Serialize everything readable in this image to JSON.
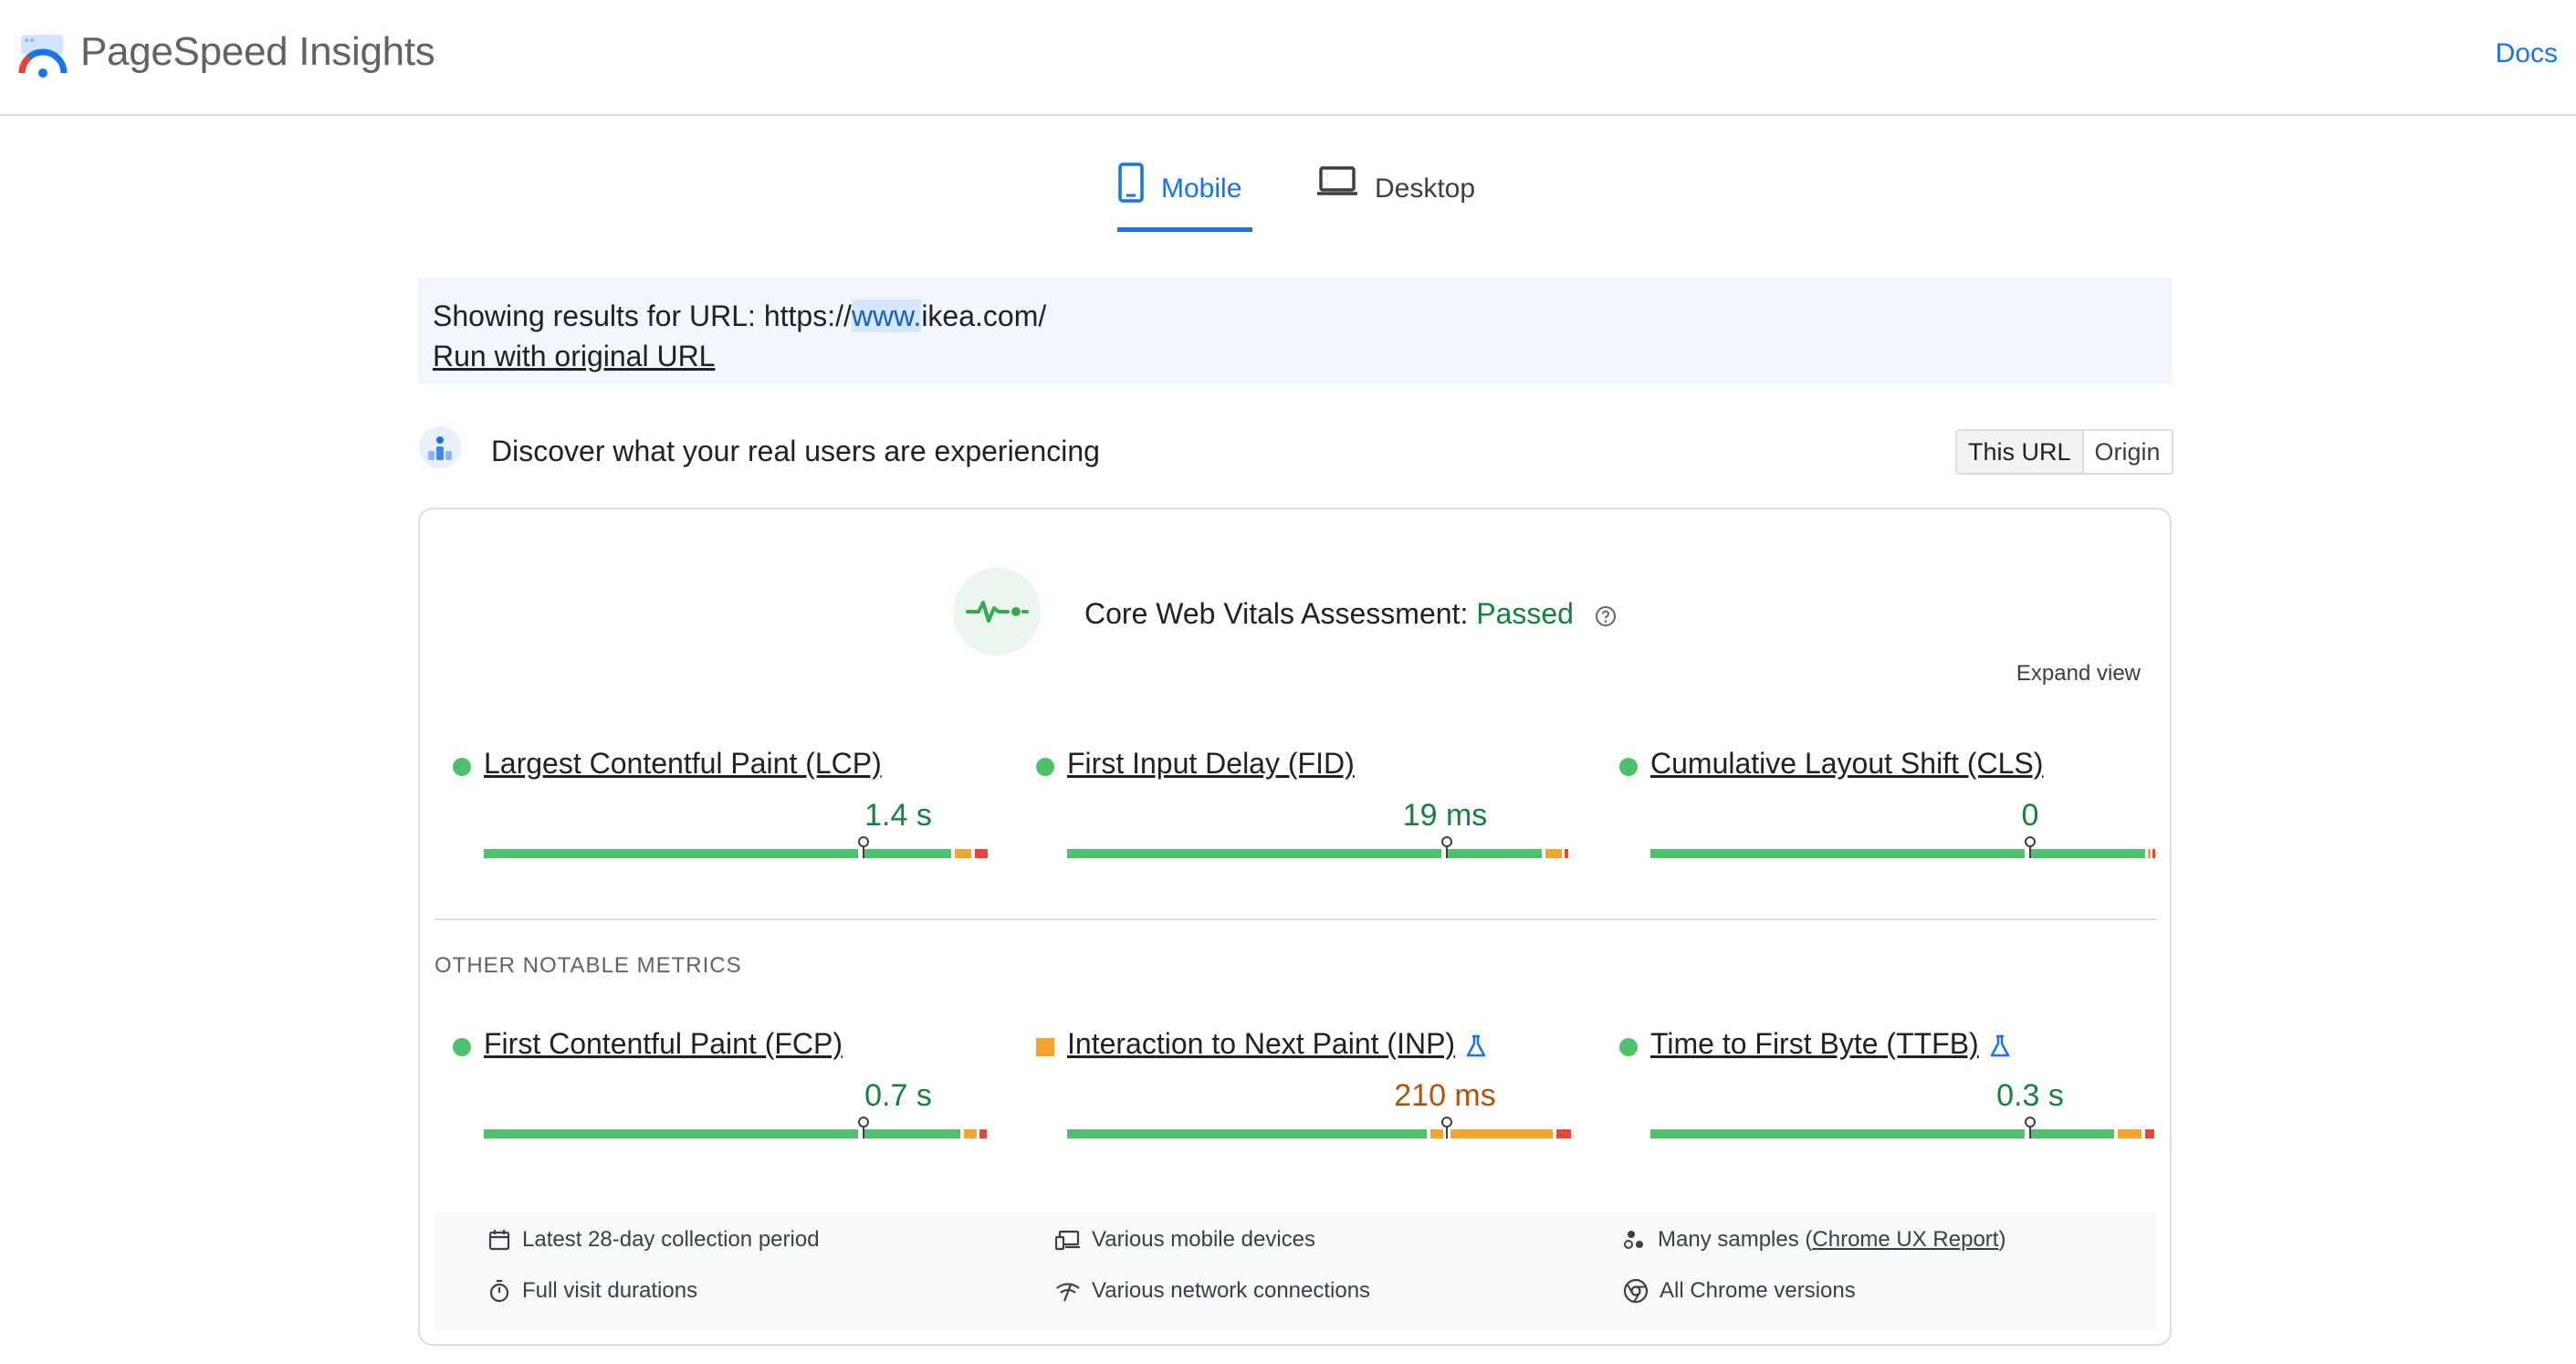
{
  "app": {
    "title": "PageSpeed Insights",
    "docs_label": "Docs"
  },
  "tabs": [
    {
      "label": "Mobile",
      "active": true,
      "icon": "phone-icon"
    },
    {
      "label": "Desktop",
      "active": false,
      "icon": "laptop-icon"
    }
  ],
  "notice": {
    "prefix": "Showing results for URL: https://",
    "highlight": "www.",
    "suffix": "ikea.com/",
    "run_original": "Run with original URL"
  },
  "discover": {
    "title": "Discover what your real users are experiencing",
    "toggle": [
      "This URL",
      "Origin"
    ],
    "toggle_selected": "This URL"
  },
  "assessment": {
    "label": "Core Web Vitals Assessment:",
    "status": "Passed",
    "expand_label": "Expand view"
  },
  "core_metrics": [
    {
      "label": "Largest Contentful Paint (LCP)",
      "value": "1.4 s",
      "status": "good",
      "experimental": false
    },
    {
      "label": "First Input Delay (FID)",
      "value": "19 ms",
      "status": "good",
      "experimental": false
    },
    {
      "label": "Cumulative Layout Shift (CLS)",
      "value": "0",
      "status": "good",
      "experimental": false
    }
  ],
  "other_heading": "OTHER NOTABLE METRICS",
  "other_metrics": [
    {
      "label": "First Contentful Paint (FCP)",
      "value": "0.7 s",
      "status": "good",
      "experimental": false
    },
    {
      "label": "Interaction to Next Paint (INP)",
      "value": "210 ms",
      "status": "needs-improvement",
      "experimental": true
    },
    {
      "label": "Time to First Byte (TTFB)",
      "value": "0.3 s",
      "status": "good",
      "experimental": true
    }
  ],
  "footer": {
    "items": [
      {
        "text": "Latest 28-day collection period",
        "icon": "calendar-icon"
      },
      {
        "text": "Various mobile devices",
        "icon": "devices-icon"
      },
      {
        "text": "Many samples (",
        "link": "Chrome UX Report",
        "after": ")",
        "icon": "samples-icon"
      },
      {
        "text": "Full visit durations",
        "icon": "timer-icon"
      },
      {
        "text": "Various network connections",
        "icon": "network-icon"
      },
      {
        "text": "All Chrome versions",
        "icon": "chrome-icon"
      }
    ]
  },
  "colors": {
    "accent": "#1a73e8",
    "good": "#4fc06b",
    "average": "#f4a52d",
    "poor": "#e8453c",
    "good_text": "#188038"
  }
}
